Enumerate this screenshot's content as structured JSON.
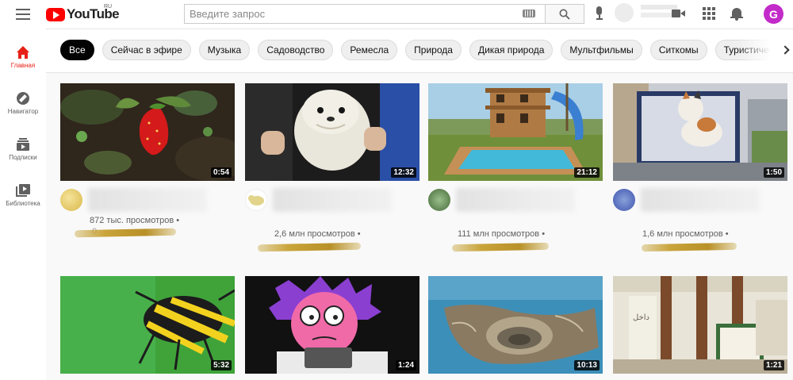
{
  "header": {
    "logo_text": "YouTube",
    "logo_region": "RU",
    "search_placeholder": "Введите запрос",
    "avatar_letter": "G",
    "avatar_color": "#c22bc9",
    "icons": [
      "menu-icon",
      "keyboard-icon",
      "search-icon",
      "mic-icon",
      "create-video-icon",
      "apps-icon",
      "notifications-icon"
    ]
  },
  "sidebar": {
    "items": [
      {
        "label": "Главная",
        "icon": "home-icon",
        "active": true
      },
      {
        "label": "Навигатор",
        "icon": "explore-icon",
        "active": false
      },
      {
        "label": "Подписки",
        "icon": "subscriptions-icon",
        "active": false
      },
      {
        "label": "Библиотека",
        "icon": "library-icon",
        "active": false
      }
    ]
  },
  "chips": [
    "Все",
    "Сейчас в эфире",
    "Музыка",
    "Садоводство",
    "Ремесла",
    "Природа",
    "Дикая природа",
    "Мультфильмы",
    "Ситкомы",
    "Туристические н"
  ],
  "videos": [
    {
      "duration": "0:54",
      "views": "872 тыс. просмотров •",
      "extra": "0"
    },
    {
      "duration": "12:32",
      "views": "2,6 млн просмотров •"
    },
    {
      "duration": "21:12",
      "views": "111 млн просмотров •"
    },
    {
      "duration": "1:50",
      "views": "1,6 млн просмотров •"
    },
    {
      "duration": "5:32"
    },
    {
      "duration": "1:24"
    },
    {
      "duration": "10:13"
    },
    {
      "duration": "1:21"
    }
  ],
  "colors": {
    "accent": "#e62117",
    "brand": "#ff0000"
  }
}
